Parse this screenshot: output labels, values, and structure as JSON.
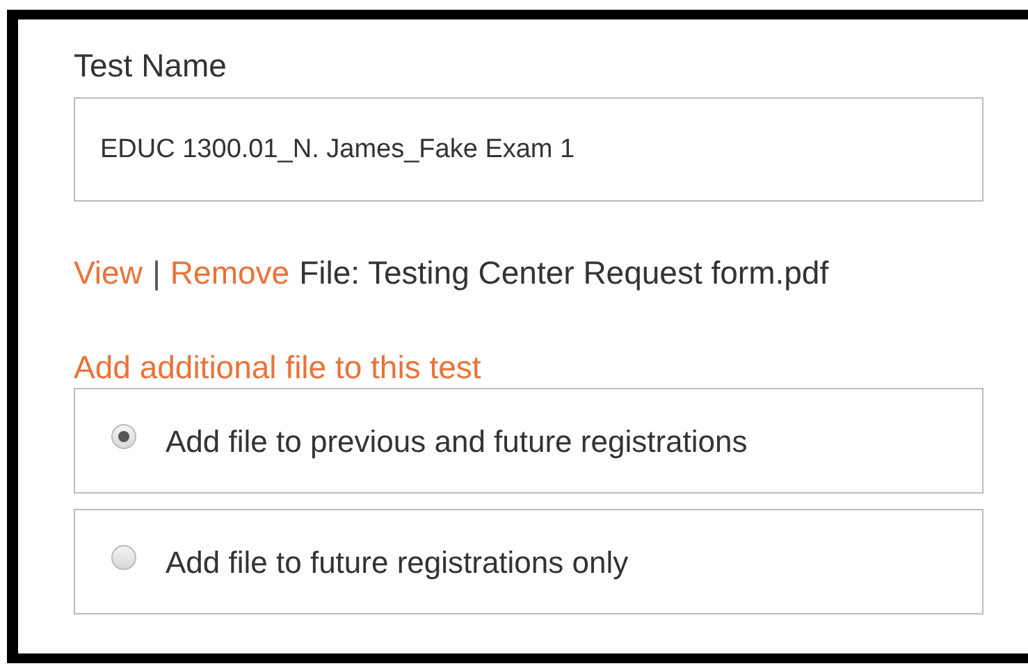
{
  "test_name": {
    "label": "Test Name",
    "value": "EDUC 1300.01_N. James_Fake Exam 1"
  },
  "file_row": {
    "view_link": "View",
    "separator": "|",
    "remove_link": "Remove",
    "file_text": "File: Testing Center Request form.pdf"
  },
  "add_file_link": "Add additional file to this test",
  "options": [
    {
      "label": "Add file to previous and future registrations",
      "selected": true
    },
    {
      "label": "Add file to future registrations only",
      "selected": false
    }
  ]
}
